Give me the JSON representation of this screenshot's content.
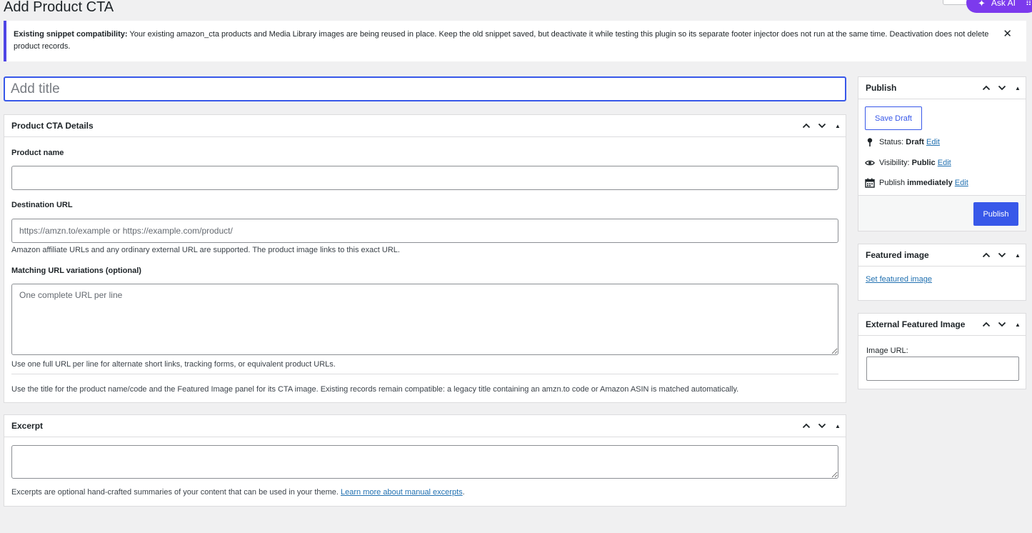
{
  "header": {
    "page_title": "Add Product CTA",
    "ask_ai_label": "Ask AI"
  },
  "notice": {
    "strong": "Existing snippet compatibility:",
    "text": " Your existing amazon_cta products and Media Library images are being reused in place. Keep the old snippet saved, but deactivate it while testing this plugin so its separate footer injector does not run at the same time. Deactivation does not delete product records.",
    "dismiss": "✕"
  },
  "title_field": {
    "placeholder": "Add title",
    "value": ""
  },
  "product_cta": {
    "title": "Product CTA Details",
    "product_name_label": "Product name",
    "product_name_value": "",
    "destination_label": "Destination URL",
    "destination_placeholder": "https://amzn.to/example or https://example.com/product/",
    "destination_help": "Amazon affiliate URLs and any ordinary external URL are supported. The product image links to this exact URL.",
    "variations_label": "Matching URL variations (optional)",
    "variations_placeholder": "One complete URL per line",
    "variations_help": "Use one full URL per line for alternate short links, tracking forms, or equivalent product URLs.",
    "footer_note": "Use the title for the product name/code and the Featured Image panel for its CTA image. Existing records remain compatible: a legacy title containing an amzn.to code or Amazon ASIN is matched automatically."
  },
  "excerpt": {
    "title": "Excerpt",
    "value": "",
    "help_text": "Excerpts are optional hand-crafted summaries of your content that can be used in your theme. ",
    "help_link": "Learn more about manual excerpts",
    "help_end": "."
  },
  "publish": {
    "title": "Publish",
    "save_draft": "Save Draft",
    "status_label": "Status: ",
    "status_value": "Draft",
    "visibility_label": "Visibility: ",
    "visibility_value": "Public",
    "publish_label": "Publish ",
    "publish_value": "immediately",
    "edit": "Edit",
    "publish_button": "Publish"
  },
  "featured_image": {
    "title": "Featured image",
    "set_link": "Set featured image"
  },
  "external_featured_image": {
    "title": "External Featured Image",
    "image_url_label": "Image URL:",
    "image_url_value": ""
  },
  "colors": {
    "accent": "#3858e9",
    "notice_border": "#4f46e5",
    "ask_ai": "#7c3aed",
    "background": "#f0f0f1"
  },
  "icons": [
    "close-icon",
    "chevron-up-icon",
    "chevron-down-icon",
    "toggle-triangle-icon",
    "pin-icon",
    "eye-icon",
    "calendar-icon",
    "sparkle-icon",
    "grid-icon"
  ]
}
